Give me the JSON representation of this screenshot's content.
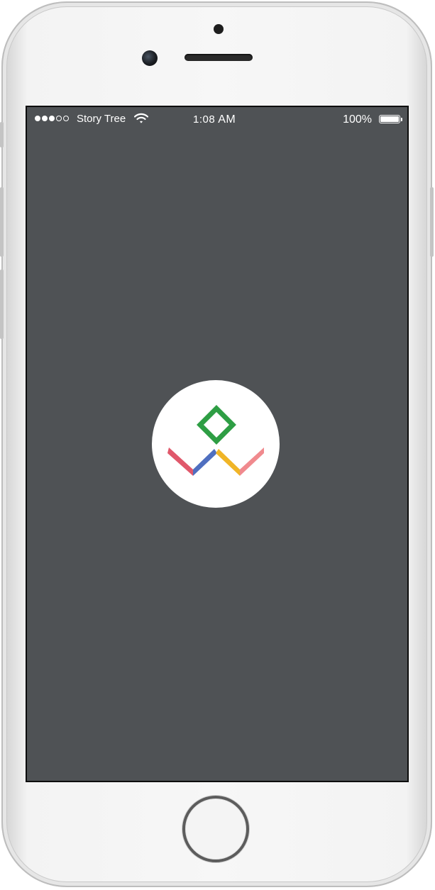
{
  "status_bar": {
    "signal_bars_filled": 3,
    "signal_bars_total": 5,
    "carrier": "Story Tree",
    "wifi_icon": "wifi-icon",
    "time": "1:08",
    "ampm": "AM",
    "battery_percent": "100%",
    "battery_icon": "battery-full-icon"
  },
  "splash": {
    "logo": "app-logo",
    "logo_colors": {
      "green": "#2e9e44",
      "red": "#e0586b",
      "blue": "#4f6fc0",
      "yellow": "#f0b527",
      "pink": "#f08a8e"
    },
    "background": "#4f5255"
  },
  "device": {
    "home_button": "home-button"
  }
}
